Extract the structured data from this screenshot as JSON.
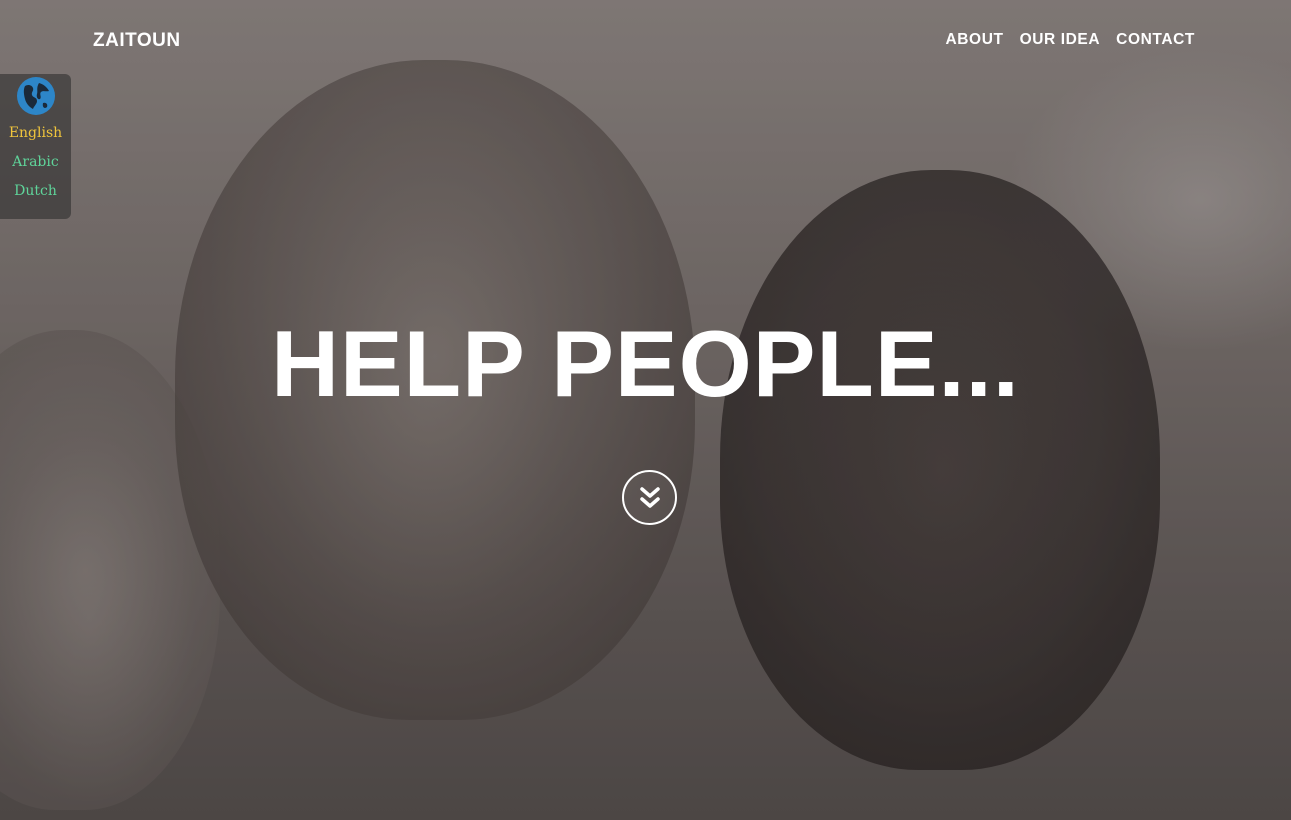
{
  "brand": {
    "name": "ZAITOUN"
  },
  "nav": {
    "items": [
      "ABOUT",
      "OUR IDEA",
      "CONTACT"
    ]
  },
  "language_switcher": {
    "icon": "globe-icon",
    "options": [
      "English",
      "Arabic",
      "Dutch"
    ],
    "active": "English",
    "colors": {
      "active": "#f0c53c",
      "inactive": "#5fd49a"
    }
  },
  "hero": {
    "headline": "HELP PEOPLE...",
    "scroll_icon": "chevron-double-down-icon"
  }
}
